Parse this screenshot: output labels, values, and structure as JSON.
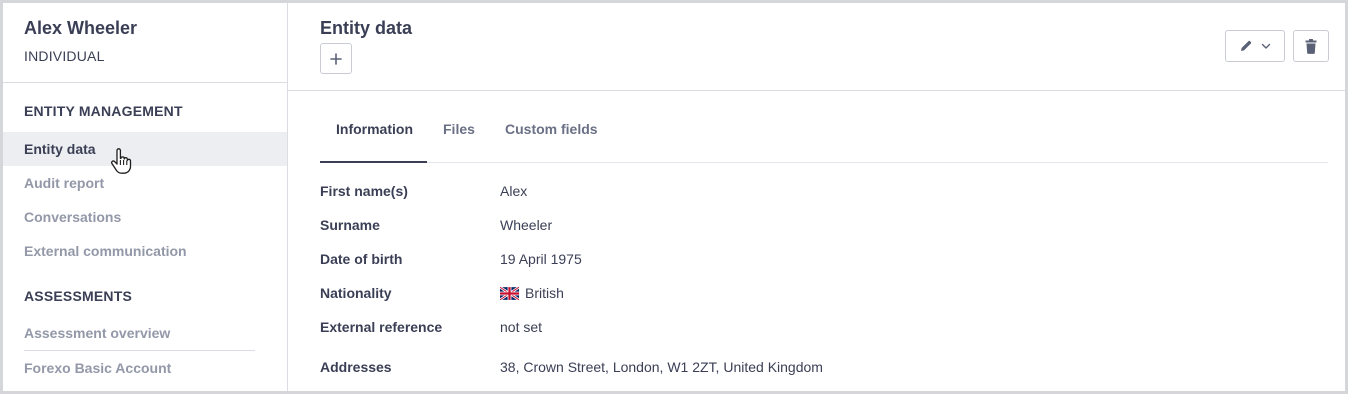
{
  "entity": {
    "name": "Alex Wheeler",
    "type": "INDIVIDUAL"
  },
  "sidebar": {
    "sections": [
      {
        "title": "ENTITY MANAGEMENT"
      },
      {
        "title": "ASSESSMENTS"
      }
    ],
    "management_items": [
      {
        "label": "Entity data",
        "active": true
      },
      {
        "label": "Audit report"
      },
      {
        "label": "Conversations"
      },
      {
        "label": "External communication"
      }
    ],
    "assessment_items": [
      {
        "label": "Assessment overview"
      },
      {
        "label": "Forexo Basic Account"
      }
    ]
  },
  "main": {
    "title": "Entity data",
    "add_icon": "plus-icon",
    "edit_icon": "pencil-icon",
    "dropdown_icon": "chevron-down-icon",
    "delete_icon": "trash-icon",
    "tabs": [
      {
        "label": "Information",
        "active": true
      },
      {
        "label": "Files"
      },
      {
        "label": "Custom fields"
      }
    ],
    "fields": [
      {
        "label": "First name(s)",
        "value": "Alex"
      },
      {
        "label": "Surname",
        "value": "Wheeler"
      },
      {
        "label": "Date of birth",
        "value": "19 April 1975"
      },
      {
        "label": "Nationality",
        "value": "British",
        "icon": "uk-flag-icon"
      },
      {
        "label": "External reference",
        "value": "not set"
      },
      {
        "label": "Addresses",
        "value": "38, Crown Street, London, W1 2ZT, United Kingdom"
      }
    ]
  },
  "colors": {
    "text": "#3a3f55",
    "muted": "#9398a8",
    "active_bg": "#eceef1",
    "border": "#dcdde2"
  }
}
